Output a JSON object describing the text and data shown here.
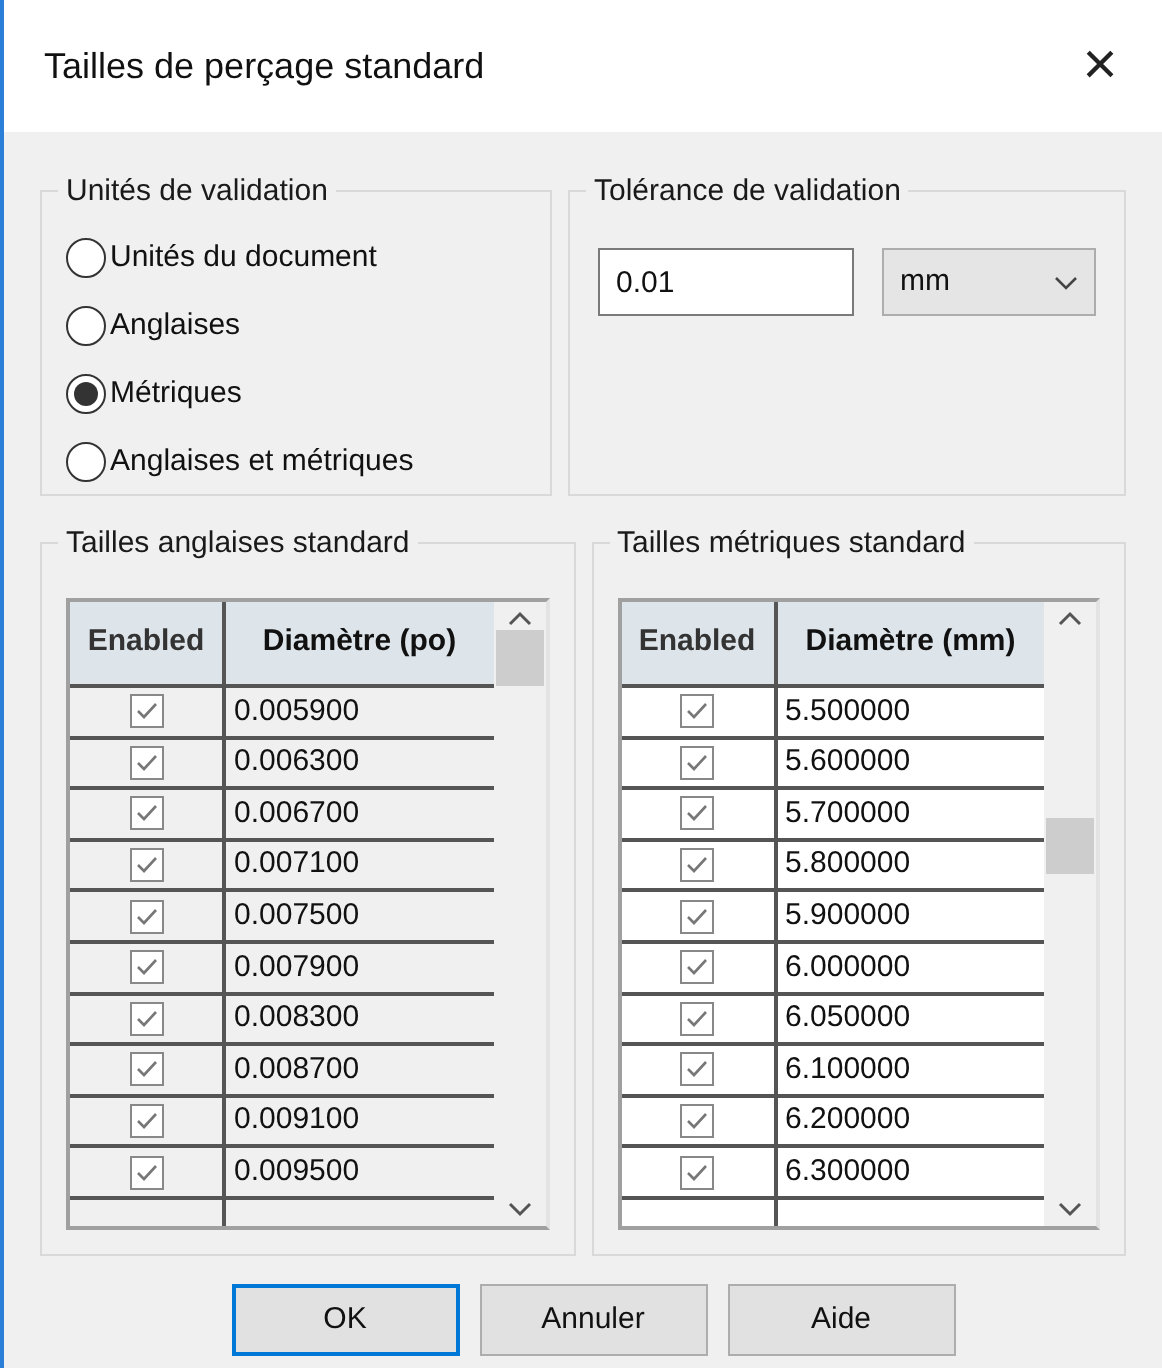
{
  "window": {
    "title": "Tailles de perçage standard",
    "close": "×"
  },
  "units": {
    "title": "Unités de validation",
    "options": [
      {
        "label": "Unités du document",
        "selected": false
      },
      {
        "label": "Anglaises",
        "selected": false
      },
      {
        "label": "Métriques",
        "selected": true
      },
      {
        "label": "Anglaises et métriques",
        "selected": false
      }
    ]
  },
  "tolerance": {
    "title": "Tolérance de validation",
    "value": "0.01",
    "unit": "mm"
  },
  "tables": [
    {
      "title": "Tailles anglaises standard",
      "disabled": true,
      "columns": [
        "Enabled",
        "Diamètre (po)"
      ],
      "rows": [
        {
          "checked": true,
          "value": "0.005900"
        },
        {
          "checked": true,
          "value": "0.006300"
        },
        {
          "checked": true,
          "value": "0.006700"
        },
        {
          "checked": true,
          "value": "0.007100"
        },
        {
          "checked": true,
          "value": "0.007500"
        },
        {
          "checked": true,
          "value": "0.007900"
        },
        {
          "checked": true,
          "value": "0.008300"
        },
        {
          "checked": true,
          "value": "0.008700"
        },
        {
          "checked": true,
          "value": "0.009100"
        },
        {
          "checked": true,
          "value": "0.009500"
        }
      ]
    },
    {
      "title": "Tailles métriques standard",
      "disabled": false,
      "columns": [
        "Enabled",
        "Diamètre (mm)"
      ],
      "rows": [
        {
          "checked": true,
          "value": "5.500000"
        },
        {
          "checked": true,
          "value": "5.600000"
        },
        {
          "checked": true,
          "value": "5.700000"
        },
        {
          "checked": true,
          "value": "5.800000"
        },
        {
          "checked": true,
          "value": "5.900000"
        },
        {
          "checked": true,
          "value": "6.000000"
        },
        {
          "checked": true,
          "value": "6.050000"
        },
        {
          "checked": true,
          "value": "6.100000"
        },
        {
          "checked": true,
          "value": "6.200000"
        },
        {
          "checked": true,
          "value": "6.300000"
        }
      ]
    }
  ],
  "buttons": [
    {
      "label": "OK",
      "default": true
    },
    {
      "label": "Annuler",
      "default": false
    },
    {
      "label": "Aide",
      "default": false
    }
  ]
}
